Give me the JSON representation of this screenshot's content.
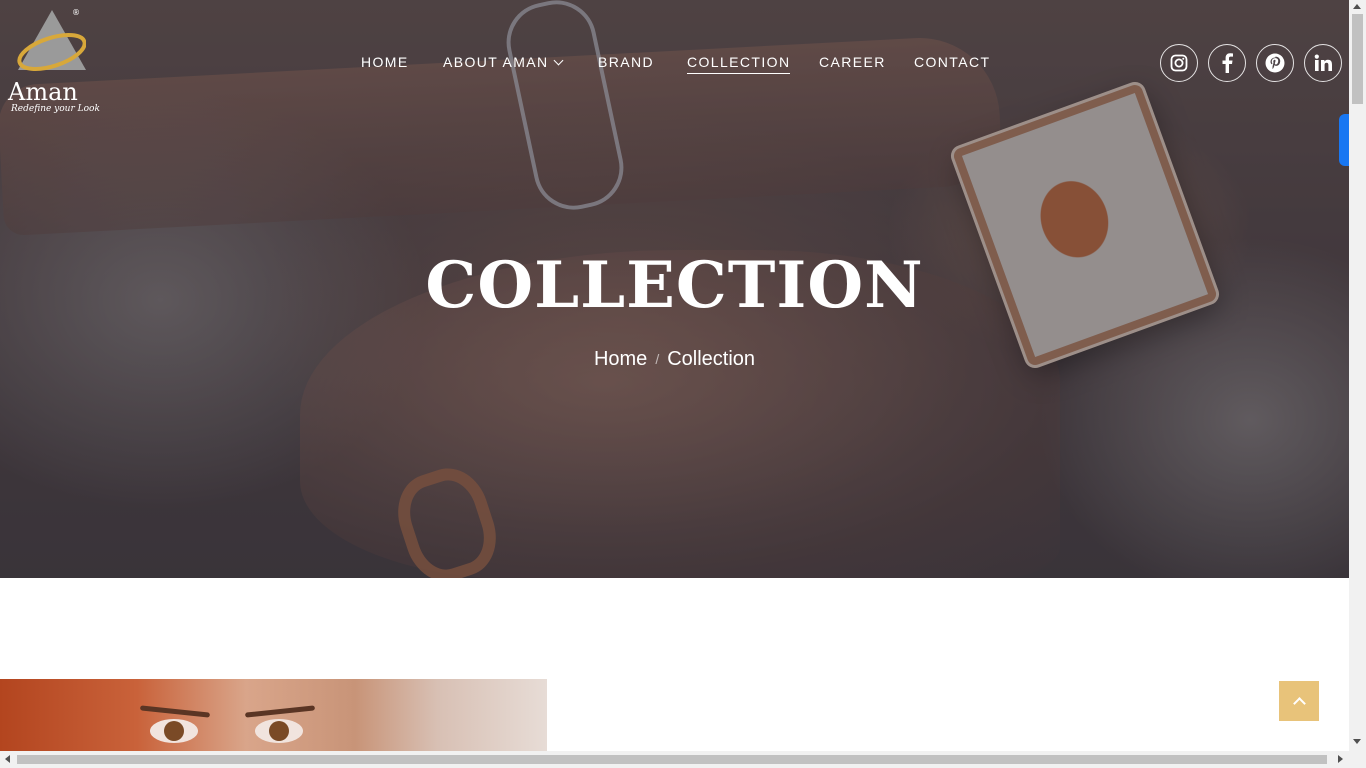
{
  "brand": {
    "name": "Aman",
    "tagline": "Redefine your Look",
    "registered": "®"
  },
  "nav": {
    "items": [
      {
        "label": "HOME"
      },
      {
        "label": "ABOUT AMAN"
      },
      {
        "label": "BRAND"
      },
      {
        "label": "COLLECTION"
      },
      {
        "label": "CAREER"
      },
      {
        "label": "CONTACT"
      }
    ],
    "active": "COLLECTION"
  },
  "social": [
    "instagram-icon",
    "facebook-icon",
    "pinterest-icon",
    "linkedin-icon"
  ],
  "hero": {
    "title": "COLLECTION",
    "breadcrumb": {
      "home": "Home",
      "separator": "/",
      "current": "Collection"
    }
  },
  "colors": {
    "accent": "#e8c37a",
    "side_tab": "#1877f2",
    "text_light": "#ffffff"
  }
}
